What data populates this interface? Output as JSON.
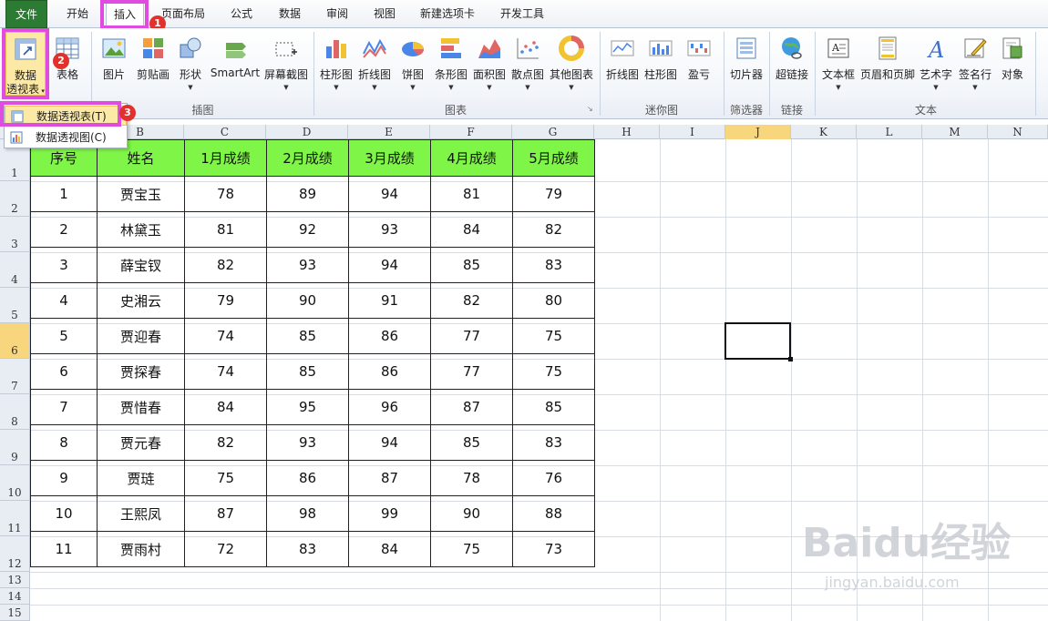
{
  "tabs": [
    {
      "label": "文件"
    },
    {
      "label": "开始"
    },
    {
      "label": "插入"
    },
    {
      "label": "页面布局"
    },
    {
      "label": "公式"
    },
    {
      "label": "数据"
    },
    {
      "label": "审阅"
    },
    {
      "label": "视图"
    },
    {
      "label": "新建选项卡"
    },
    {
      "label": "开发工具"
    }
  ],
  "ribbon": {
    "buttons": [
      {
        "label": "数据\n透视表"
      },
      {
        "label": "表格"
      },
      {
        "label": "图片"
      },
      {
        "label": "剪贴画"
      },
      {
        "label": "形状"
      },
      {
        "label": "SmartArt"
      },
      {
        "label": "屏幕截图"
      },
      {
        "label": "柱形图"
      },
      {
        "label": "折线图"
      },
      {
        "label": "饼图"
      },
      {
        "label": "条形图"
      },
      {
        "label": "面积图"
      },
      {
        "label": "散点图"
      },
      {
        "label": "其他图表"
      },
      {
        "label": "折线图"
      },
      {
        "label": "柱形图"
      },
      {
        "label": "盈亏"
      },
      {
        "label": "切片器"
      },
      {
        "label": "超链接"
      },
      {
        "label": "文本框"
      },
      {
        "label": "页眉和页脚"
      },
      {
        "label": "艺术字"
      },
      {
        "label": "签名行"
      },
      {
        "label": "对象"
      }
    ],
    "pivot_label_line1": "数据",
    "pivot_label_line2": "透视表",
    "groups": [
      "插图",
      "图表",
      "迷你图",
      "筛选器",
      "链接",
      "文本"
    ]
  },
  "menu": {
    "items": [
      {
        "label": "数据透视表(T)"
      },
      {
        "label": "数据透视图(C)"
      }
    ]
  },
  "badges": [
    "1",
    "2",
    "3"
  ],
  "columns": [
    "B",
    "C",
    "D",
    "E",
    "F",
    "G",
    "H",
    "I",
    "J",
    "K",
    "L",
    "M",
    "N"
  ],
  "rows": [
    "1",
    "2",
    "3",
    "4",
    "5",
    "6",
    "7",
    "8",
    "9",
    "10",
    "11",
    "12",
    "13",
    "14",
    "15"
  ],
  "table": {
    "headers": [
      "序号",
      "姓名",
      "1月成绩",
      "2月成绩",
      "3月成绩",
      "4月成绩",
      "5月成绩"
    ],
    "rows": [
      [
        "1",
        "贾宝玉",
        "78",
        "89",
        "94",
        "81",
        "79"
      ],
      [
        "2",
        "林黛玉",
        "81",
        "92",
        "93",
        "84",
        "82"
      ],
      [
        "3",
        "薛宝钗",
        "82",
        "93",
        "94",
        "85",
        "83"
      ],
      [
        "4",
        "史湘云",
        "79",
        "90",
        "91",
        "82",
        "80"
      ],
      [
        "5",
        "贾迎春",
        "74",
        "85",
        "86",
        "77",
        "75"
      ],
      [
        "6",
        "贾探春",
        "74",
        "85",
        "86",
        "77",
        "75"
      ],
      [
        "7",
        "贾惜春",
        "84",
        "95",
        "96",
        "87",
        "85"
      ],
      [
        "8",
        "贾元春",
        "82",
        "93",
        "94",
        "85",
        "83"
      ],
      [
        "9",
        "贾琏",
        "75",
        "86",
        "87",
        "78",
        "76"
      ],
      [
        "10",
        "王熙凤",
        "87",
        "98",
        "99",
        "90",
        "88"
      ],
      [
        "11",
        "贾雨村",
        "72",
        "83",
        "84",
        "75",
        "73"
      ]
    ]
  },
  "watermark": {
    "brand": "Baidu经验",
    "url": "jingyan.baidu.com"
  },
  "colors": {
    "header_fill": "#7ff548",
    "highlight": "#e04be0",
    "badge": "#e2312d",
    "file_tab": "#2c7b32"
  }
}
